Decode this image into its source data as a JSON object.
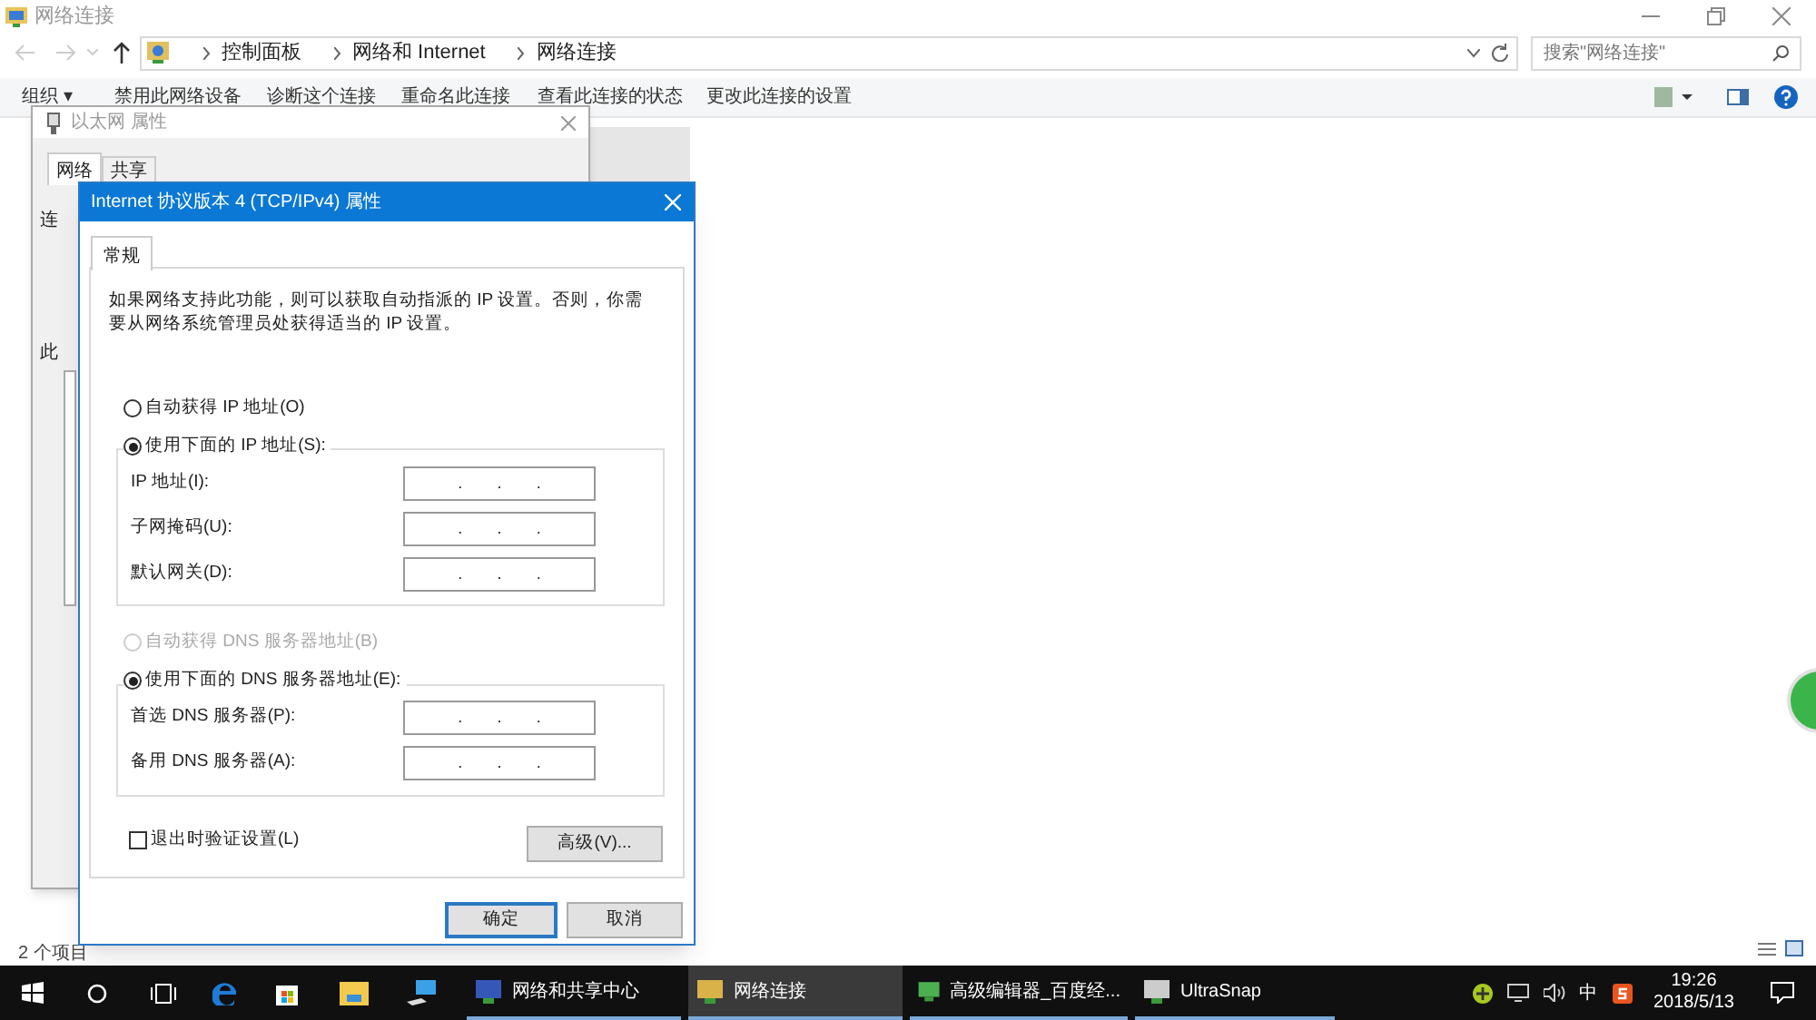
{
  "explorer": {
    "title": "网络连接",
    "path": [
      "控制面板",
      "网络和 Internet",
      "网络连接"
    ],
    "search": {
      "placeholder": "搜索\"网络连接\""
    },
    "toolbar": [
      "组织 ▾",
      "禁用此网络设备",
      "诊断这个连接",
      "重命名此连接",
      "查看此连接的状态",
      "更改此连接的设置"
    ],
    "status_bar": [
      "2 个项目"
    ]
  },
  "back_dialog": {
    "title": "以太网 属性",
    "tabs": [
      {
        "label": "网络",
        "selected": true
      },
      {
        "label": "共享",
        "selected": false
      }
    ],
    "partial_labels": [
      "连",
      "此"
    ]
  },
  "ipv4_dialog": {
    "title": "Internet 协议版本 4 (TCP/IPv4) 属性",
    "tabs": [
      {
        "label": "常规",
        "selected": true
      }
    ],
    "description": "如果网络支持此功能，则可以获取自动指派的 IP 设置。否则，你需要从网络系统管理员处获得适当的 IP 设置。",
    "ip_options": [
      {
        "label": "自动获得 IP 地址(O)",
        "selected": false,
        "disabled": false
      },
      {
        "label": "使用下面的 IP 地址(S):",
        "selected": true,
        "disabled": false
      }
    ],
    "ip_fields": [
      {
        "label": "IP 地址(I):",
        "separators": [
          ".",
          ".",
          "."
        ]
      },
      {
        "label": "子网掩码(U):",
        "separators": [
          ".",
          ".",
          "."
        ]
      },
      {
        "label": "默认网关(D):",
        "separators": [
          ".",
          ".",
          "."
        ]
      }
    ],
    "dns_options": [
      {
        "label": "自动获得 DNS 服务器地址(B)",
        "selected": false,
        "disabled": true
      },
      {
        "label": "使用下面的 DNS 服务器地址(E):",
        "selected": true,
        "disabled": false
      }
    ],
    "dns_fields": [
      {
        "label": "首选 DNS 服务器(P):",
        "separators": [
          ".",
          ".",
          "."
        ]
      },
      {
        "label": "备用 DNS 服务器(A):",
        "separators": [
          ".",
          ".",
          "."
        ]
      }
    ],
    "validate": {
      "label": "退出时验证设置(L)",
      "checked": false
    },
    "buttons": [
      {
        "label": "高级(V)...",
        "kind": "advanced"
      },
      {
        "label": "确定",
        "kind": "default"
      },
      {
        "label": "取消",
        "kind": "normal"
      }
    ]
  },
  "taskbar": {
    "apps": [
      {
        "label": "网络和共享中心",
        "selected": false
      },
      {
        "label": "网络连接",
        "selected": true
      },
      {
        "label": "高级编辑器_百度经...",
        "selected": false
      },
      {
        "label": "UltraSnap",
        "selected": false
      }
    ],
    "ime": "中",
    "time": "19:26",
    "date": "2018/5/13"
  }
}
